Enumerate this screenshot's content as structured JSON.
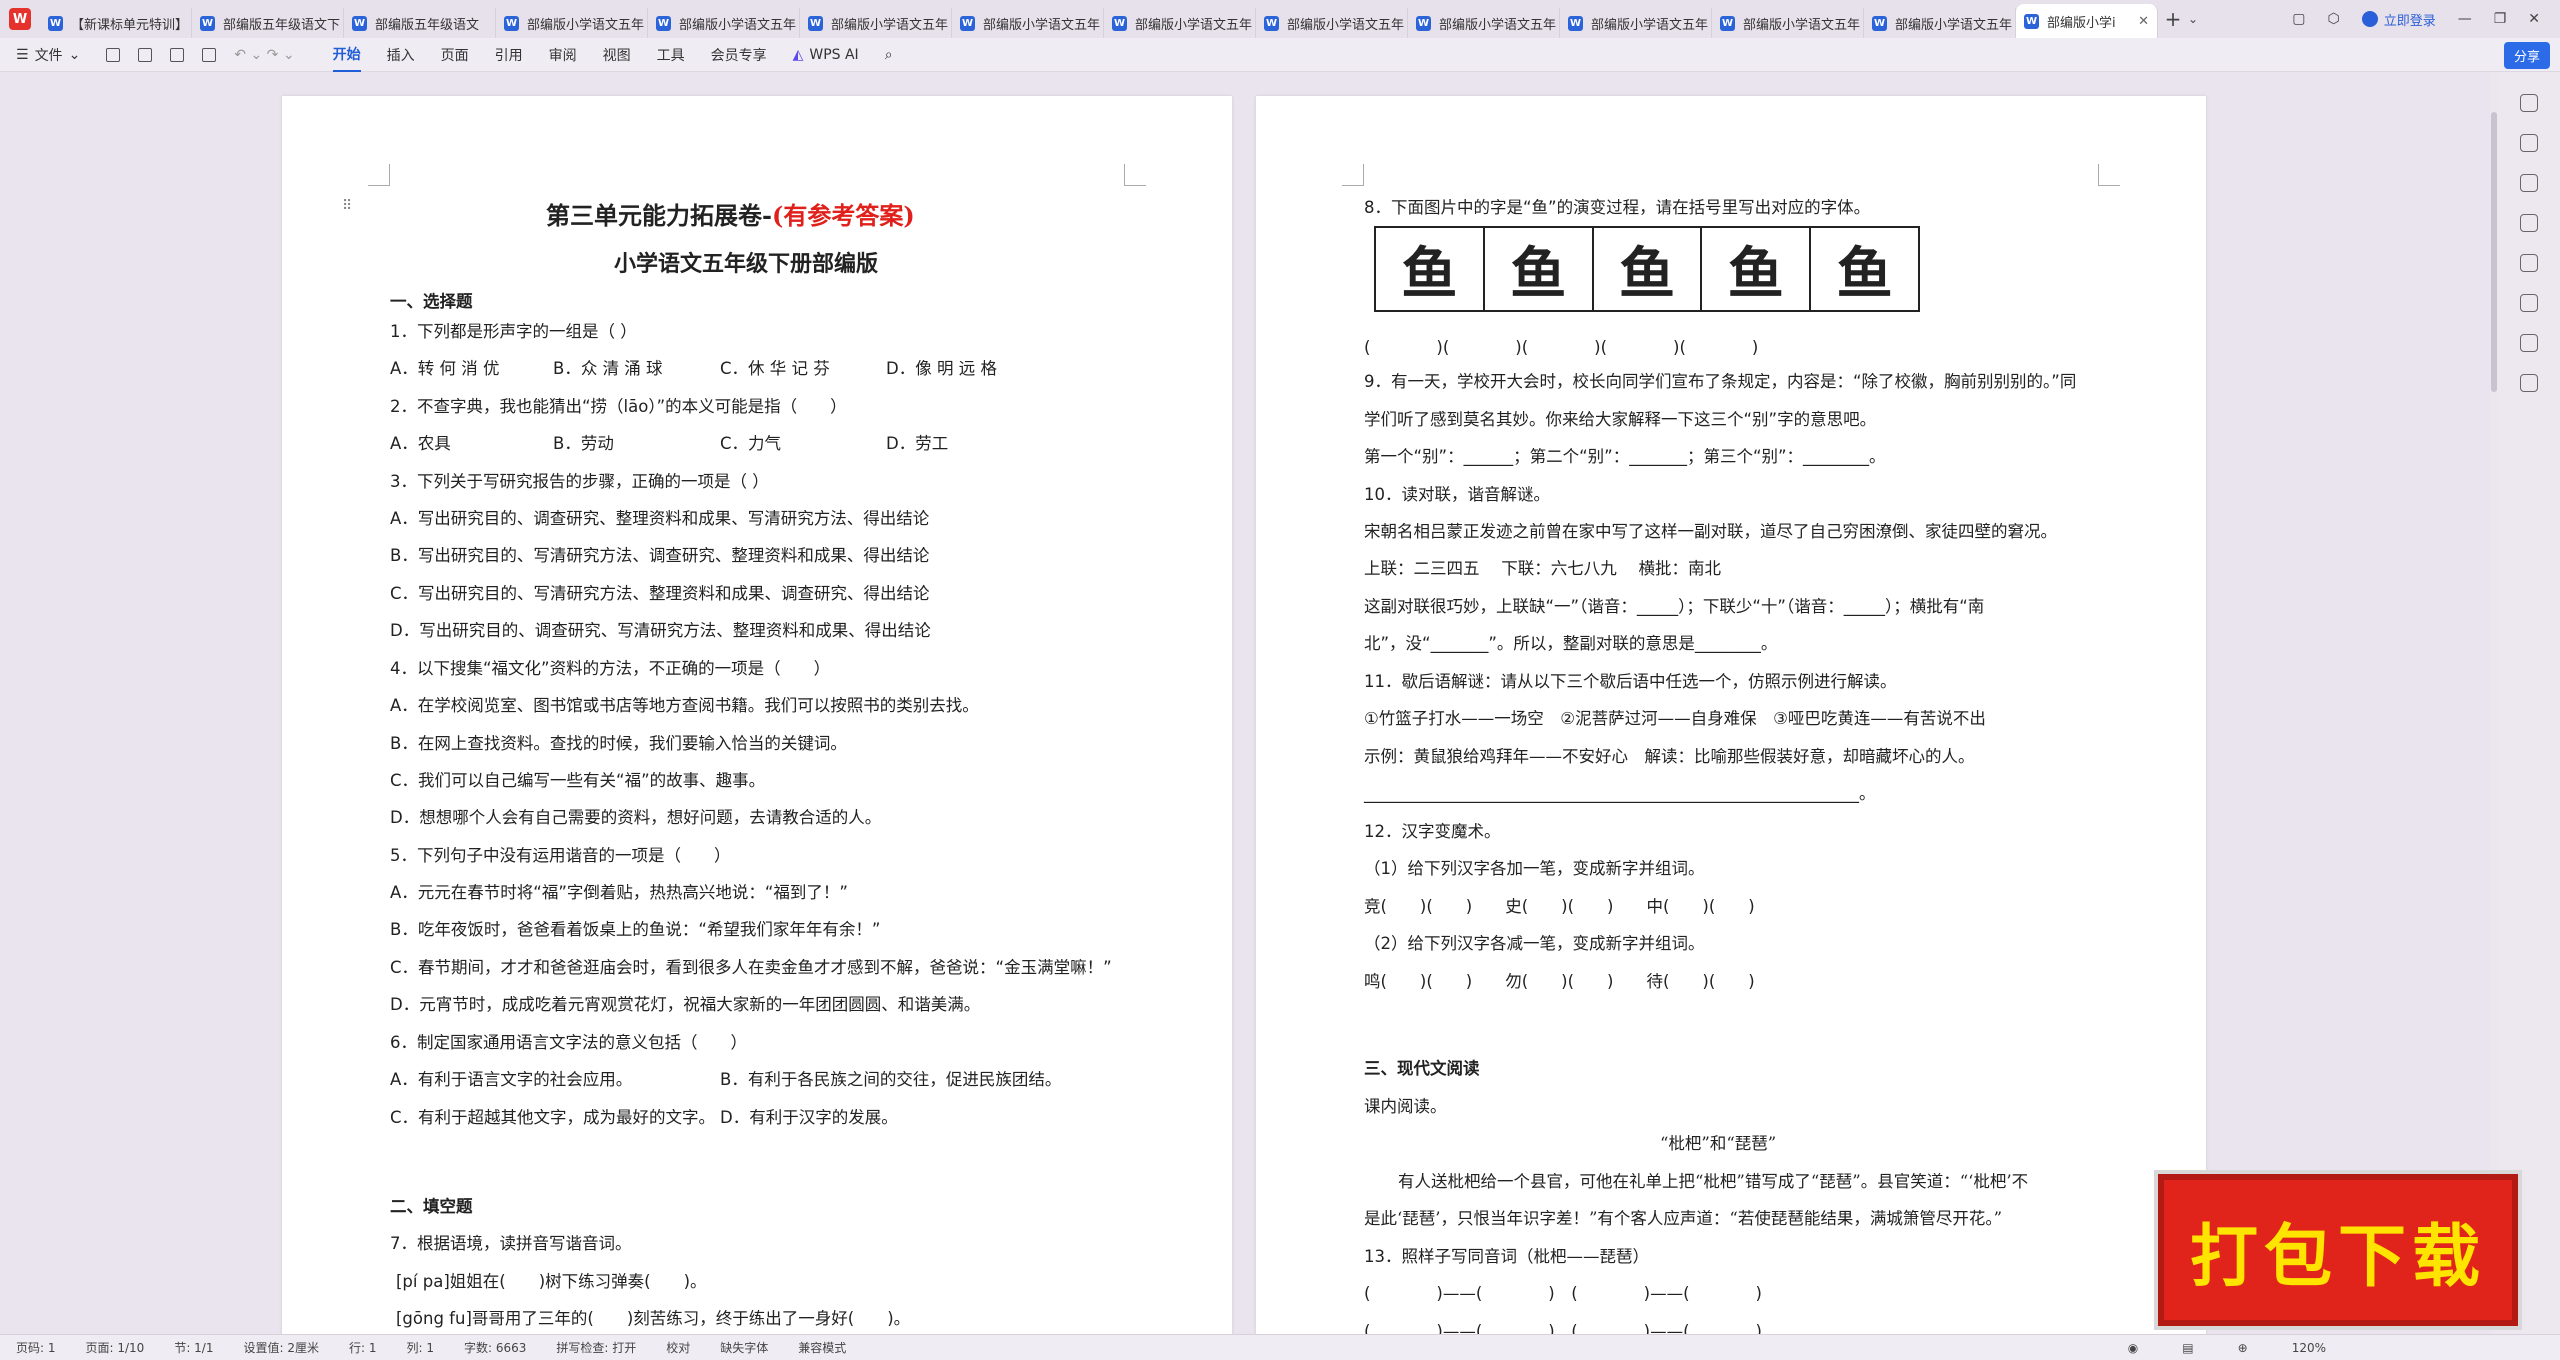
{
  "tabs": [
    "【新课标单元特训】",
    "部编版五年级语文下",
    "部编版五年级语文",
    "部编版小学语文五年",
    "部编版小学语文五年",
    "部编版小学语文五年",
    "部编版小学语文五年",
    "部编版小学语文五年",
    "部编版小学语文五年",
    "部编版小学语文五年",
    "部编版小学语文五年",
    "部编版小学语文五年",
    "部编版小学语文五年",
    "部编版小学i"
  ],
  "login": "立即登录",
  "menu": {
    "file": "文件",
    "items": [
      "开始",
      "插入",
      "页面",
      "引用",
      "审阅",
      "视图",
      "工具",
      "会员专享"
    ],
    "ai": "WPS AI",
    "share": "分享"
  },
  "p1": {
    "title_black": "第三单元能力拓展卷-",
    "title_red": "(有参考答案)",
    "subtitle": "小学语文五年级下册部编版",
    "lines": [
      "一、选择题",
      "1．下列都是形声字的一组是（ ）",
      "A．转 何 消 优",
      "B．众 清 涌 球",
      "C．休 华 记 芬",
      "D．像 明 远 格",
      "2．不查字典，我也能猜出“捞（lāo）”的本义可能是指（　　）",
      "A．农具",
      "B．劳动",
      "C．力气",
      "D．劳工",
      "3．下列关于写研究报告的步骤，正确的一项是（ ）",
      "A．写出研究目的、调查研究、整理资料和成果、写清研究方法、得出结论",
      "B．写出研究目的、写清研究方法、调查研究、整理资料和成果、得出结论",
      "C．写出研究目的、写清研究方法、整理资料和成果、调查研究、得出结论",
      "D．写出研究目的、调查研究、写清研究方法、整理资料和成果、得出结论",
      "4．以下搜集“福文化”资料的方法，不正确的一项是（　　）",
      "A．在学校阅览室、图书馆或书店等地方查阅书籍。我们可以按照书的类别去找。",
      "B．在网上查找资料。查找的时候，我们要输入恰当的关键词。",
      "C．我们可以自己编写一些有关“福”的故事、趣事。",
      "D．想想哪个人会有自己需要的资料，想好问题，去请教合适的人。",
      "5．下列句子中没有运用谐音的一项是（　　）",
      "A．元元在春节时将“福”字倒着贴，热热高兴地说：“福到了！”",
      "B．吃年夜饭时，爸爸看着饭桌上的鱼说：“希望我们家年年有余！”",
      "C．春节期间，才才和爸爸逛庙会时，看到很多人在卖金鱼才才感到不解，爸爸说：“金玉满堂嘛！”",
      "D．元宵节时，成成吃着元宵观赏花灯，祝福大家新的一年团团圆圆、和谐美满。",
      "6．制定国家通用语言文字法的意义包括（　　）",
      "A．有利于语言文字的社会应用。",
      "B．有利于各民族之间的交往，促进民族团结。",
      "C．有利于超越其他文字，成为最好的文字。",
      "D．有利于汉字的发展。",
      "二、填空题",
      "7．根据语境，读拼音写谐音词。",
      "[pí pa]姐姐在(　　)树下练习弹奏(　　)。",
      "[gōng fu]哥哥用了三年的(　　)刻苦练习，终于练出了一身好(　　)。"
    ]
  },
  "p2": {
    "fish_glyphs": [
      "鱼",
      "鱼",
      "鱼",
      "鱼",
      "鱼"
    ],
    "lines": [
      "8．下面图片中的字是“鱼”的演变过程，请在括号里写出对应的字体。",
      "(　　　　)(　　　　)(　　　　)(　　　　)(　　　　)",
      "9．有一天，学校开大会时，校长向同学们宣布了条规定，内容是：“除了校徽，胸前别别别的。”同",
      "学们听了感到莫名其妙。你来给大家解释一下这三个“别”字的意思吧。",
      "第一个“别”：______；第二个“别”：_______；第三个“别”：________。",
      "10．读对联，谐音解谜。",
      "宋朝名相吕蒙正发迹之前曾在家中写了这样一副对联，道尽了自己穷困潦倒、家徒四壁的窘况。",
      "上联：二三四五　 下联：六七八九　 横批：南北",
      "这副对联很巧妙，上联缺“一”（谐音：_____）；下联少“十”（谐音：_____）；横批有“南",
      "北”，没“_______”。所以，整副对联的意思是________。",
      "11．歇后语解谜：请从以下三个歇后语中任选一个，仿照示例进行解读。",
      "①竹篮子打水——一场空　②泥菩萨过河——自身难保　③哑巴吃黄连——有苦说不出",
      "示例：黄鼠狼给鸡拜年——不安好心　解读：比喻那些假装好意，却暗藏坏心的人。",
      "____________________________________________________________。",
      "12．汉字变魔术。",
      "（1）给下列汉字各加一笔，变成新字并组词。",
      "竞(　　)(　　)　　史(　　)(　　)　　中(　　)(　　)",
      "（2）给下列汉字各减一笔，变成新字并组词。",
      "鸣(　　)(　　)　　勿(　　)(　　)　　待(　　)(　　)",
      "三、现代文阅读",
      "课内阅读。",
      "“枇杷”和“琵琶”",
      "有人送枇杷给一个县官，可他在礼单上把“枇杷”错写成了“琵琶”。县官笑道：“‘枇杷’不",
      "是此‘琵琶’，只恨当年识字差！”有个客人应声道：“若使琵琶能结果，满城箫管尽开花。”",
      "13．照样子写同音词（枇杷——琵琶）",
      "(　　　　)——(　　　　)　(　　　　)——(　　　　)",
      "(　　　　)——(　　　　)　(　　　　)——(　　　　)"
    ]
  },
  "status": [
    "页码: 1",
    "页面: 1/10",
    "节: 1/1",
    "设置值: 2厘米",
    "行: 1",
    "列: 1",
    "字数: 6663",
    "拼写检查: 打开",
    "校对",
    "缺失字体",
    "兼容模式"
  ],
  "zoom": "120%",
  "banner": "打包下载"
}
